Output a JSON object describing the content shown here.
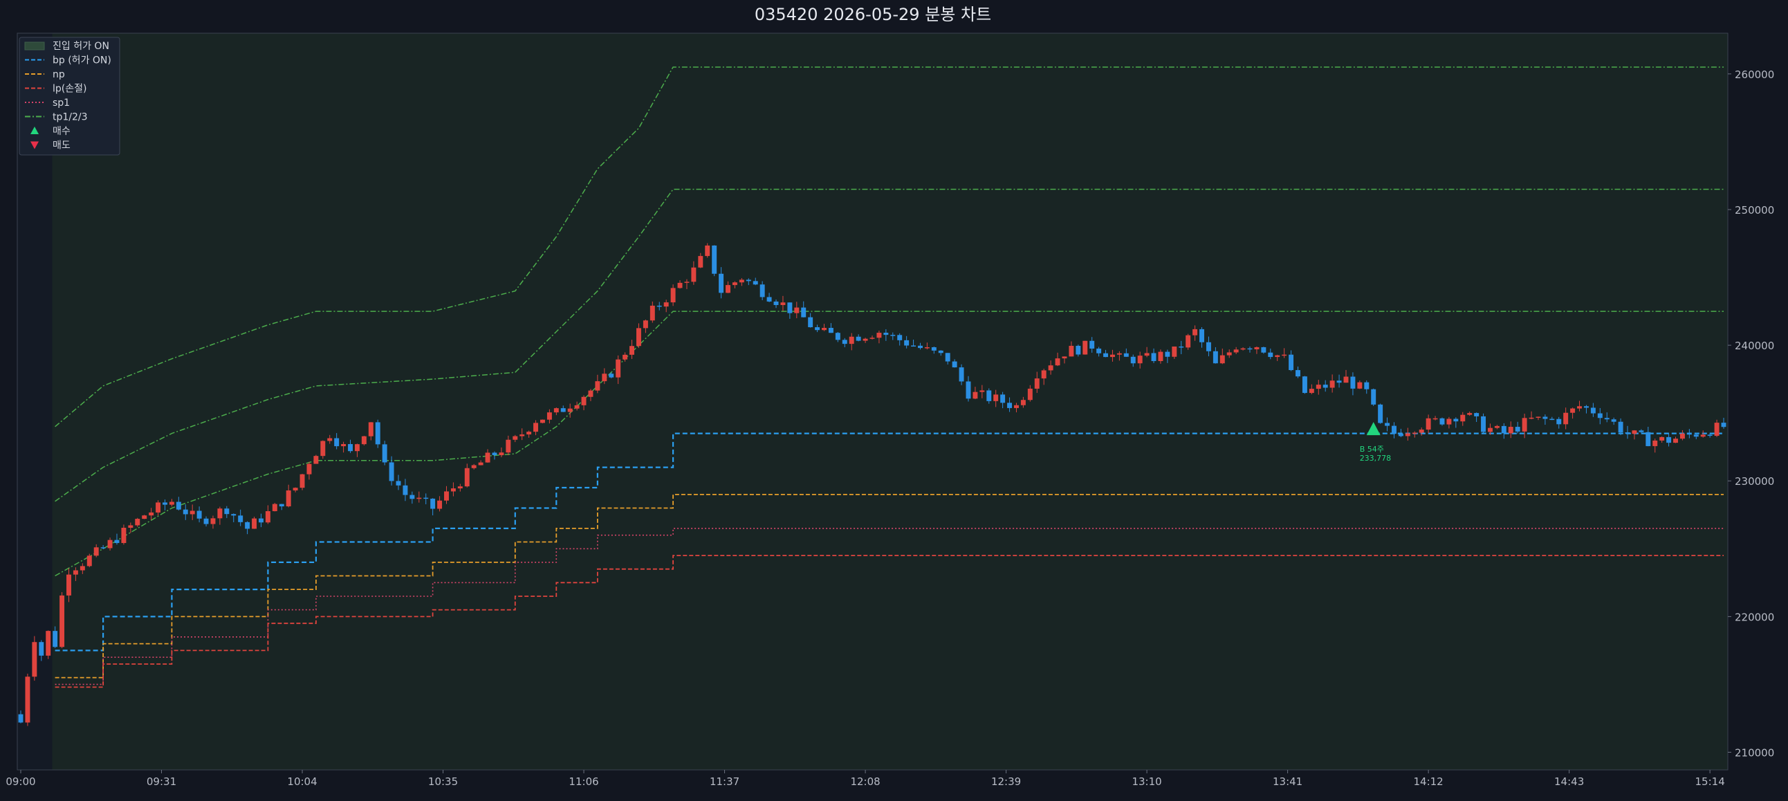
{
  "title": "035420  2026-05-29  분봉 차트",
  "colors": {
    "background": "#121620",
    "plot_bg": "#192524",
    "plot_bg_off": "#141a25",
    "up": "#e0443e",
    "down": "#2b8fe3",
    "bp": "#2b9ff0",
    "np": "#e79e2a",
    "lp": "#e0443e",
    "sp1": "#d9456a",
    "tp": "#4cad4c",
    "buy": "#22d67e",
    "sell": "#e8304a"
  },
  "chart_data": {
    "type": "candlestick",
    "title": "035420  2026-05-29  분봉 차트",
    "x_tick_labels": [
      "09:00",
      "09:31",
      "10:04",
      "10:35",
      "11:06",
      "11:37",
      "12:08",
      "12:39",
      "13:10",
      "13:41",
      "14:12",
      "14:43",
      "15:14"
    ],
    "y_tick_labels": [
      "210000",
      "220000",
      "230000",
      "240000",
      "250000",
      "260000"
    ],
    "ylim": [
      208700,
      263000
    ],
    "y_axis_side": "right",
    "legend": {
      "placement": "top-left",
      "entries": [
        {
          "label": "진입 허가 ON",
          "style": "patch"
        },
        {
          "label": "bp (허가 ON)",
          "style": "dashed"
        },
        {
          "label": "np",
          "style": "dashed"
        },
        {
          "label": "lp(손절)",
          "style": "dashed"
        },
        {
          "label": "sp1",
          "style": "dotted"
        },
        {
          "label": "tp1/2/3",
          "style": "dashdot"
        },
        {
          "label": "매수",
          "style": "triangle-up"
        },
        {
          "label": "매도",
          "style": "triangle-down"
        }
      ]
    },
    "permit_on_from_minute": 5,
    "close_path": [
      [
        0,
        212200
      ],
      [
        1,
        215800
      ],
      [
        2,
        218500
      ],
      [
        3,
        217200
      ],
      [
        4,
        218800
      ],
      [
        5,
        218000
      ],
      [
        6,
        221500
      ],
      [
        7,
        223500
      ],
      [
        9,
        224000
      ],
      [
        12,
        225000
      ],
      [
        15,
        226200
      ],
      [
        18,
        227500
      ],
      [
        22,
        228500
      ],
      [
        26,
        227000
      ],
      [
        30,
        228000
      ],
      [
        33,
        226500
      ],
      [
        37,
        228000
      ],
      [
        40,
        229500
      ],
      [
        42,
        231500
      ],
      [
        45,
        233500
      ],
      [
        48,
        232000
      ],
      [
        51,
        234500
      ],
      [
        53,
        231000
      ],
      [
        56,
        229000
      ],
      [
        60,
        228000
      ],
      [
        63,
        229500
      ],
      [
        66,
        231000
      ],
      [
        69,
        232000
      ],
      [
        72,
        233000
      ],
      [
        75,
        234500
      ],
      [
        78,
        235000
      ],
      [
        81,
        236000
      ],
      [
        84,
        237000
      ],
      [
        86,
        238000
      ],
      [
        88,
        239500
      ],
      [
        90,
        241000
      ],
      [
        92,
        242500
      ],
      [
        94,
        243500
      ],
      [
        96,
        244500
      ],
      [
        98,
        245500
      ],
      [
        100,
        247000
      ],
      [
        102,
        244000
      ],
      [
        105,
        245000
      ],
      [
        108,
        244000
      ],
      [
        111,
        243000
      ],
      [
        114,
        242000
      ],
      [
        116,
        241000
      ],
      [
        120,
        240500
      ],
      [
        125,
        241000
      ],
      [
        130,
        240000
      ],
      [
        135,
        239000
      ],
      [
        138,
        236500
      ],
      [
        142,
        236000
      ],
      [
        145,
        235500
      ],
      [
        148,
        238000
      ],
      [
        152,
        239500
      ],
      [
        156,
        240000
      ],
      [
        160,
        239000
      ],
      [
        164,
        239000
      ],
      [
        168,
        239500
      ],
      [
        171,
        241000
      ],
      [
        174,
        238500
      ],
      [
        177,
        240000
      ],
      [
        180,
        240000
      ],
      [
        184,
        239000
      ],
      [
        187,
        236500
      ],
      [
        190,
        237000
      ],
      [
        193,
        237500
      ],
      [
        196,
        236500
      ],
      [
        198,
        234000
      ],
      [
        200,
        233500
      ],
      [
        203,
        234000
      ],
      [
        207,
        234500
      ],
      [
        210,
        235000
      ],
      [
        213,
        234000
      ],
      [
        216,
        233500
      ],
      [
        220,
        234500
      ],
      [
        224,
        234500
      ],
      [
        227,
        235500
      ],
      [
        230,
        235000
      ],
      [
        234,
        233500
      ],
      [
        237,
        233000
      ],
      [
        240,
        233000
      ],
      [
        244,
        233500
      ],
      [
        248,
        234000
      ]
    ],
    "series": [
      {
        "name": "bp (허가 ON)",
        "values": [
          [
            5,
            217500
          ],
          [
            12,
            220000
          ],
          [
            22,
            222000
          ],
          [
            36,
            224000
          ],
          [
            43,
            225500
          ],
          [
            60,
            226500
          ],
          [
            72,
            228000
          ],
          [
            78,
            229500
          ],
          [
            84,
            231000
          ],
          [
            95,
            233500
          ],
          [
            248,
            233500
          ]
        ]
      },
      {
        "name": "np",
        "values": [
          [
            5,
            215500
          ],
          [
            12,
            218000
          ],
          [
            22,
            220000
          ],
          [
            36,
            222000
          ],
          [
            43,
            223000
          ],
          [
            60,
            224000
          ],
          [
            72,
            225500
          ],
          [
            78,
            226500
          ],
          [
            84,
            228000
          ],
          [
            95,
            229000
          ],
          [
            248,
            229000
          ]
        ]
      },
      {
        "name": "sp1",
        "values": [
          [
            5,
            215000
          ],
          [
            12,
            217000
          ],
          [
            22,
            218500
          ],
          [
            36,
            220500
          ],
          [
            43,
            221500
          ],
          [
            60,
            222500
          ],
          [
            72,
            224000
          ],
          [
            78,
            225000
          ],
          [
            84,
            226000
          ],
          [
            95,
            226500
          ],
          [
            248,
            226500
          ]
        ]
      },
      {
        "name": "lp(손절)",
        "values": [
          [
            5,
            214800
          ],
          [
            12,
            216500
          ],
          [
            22,
            217500
          ],
          [
            36,
            219500
          ],
          [
            43,
            220000
          ],
          [
            60,
            220500
          ],
          [
            72,
            221500
          ],
          [
            78,
            222500
          ],
          [
            84,
            223500
          ],
          [
            95,
            224500
          ],
          [
            248,
            224500
          ]
        ]
      },
      {
        "name": "tp1",
        "values": [
          [
            5,
            223000
          ],
          [
            12,
            225000
          ],
          [
            22,
            228000
          ],
          [
            36,
            230500
          ],
          [
            43,
            231500
          ],
          [
            60,
            231500
          ],
          [
            72,
            232000
          ],
          [
            78,
            234000
          ],
          [
            84,
            237000
          ],
          [
            90,
            240000
          ],
          [
            95,
            242500
          ],
          [
            248,
            242500
          ]
        ]
      },
      {
        "name": "tp2",
        "values": [
          [
            5,
            228500
          ],
          [
            12,
            231000
          ],
          [
            22,
            233500
          ],
          [
            36,
            236000
          ],
          [
            43,
            237000
          ],
          [
            60,
            237500
          ],
          [
            72,
            238000
          ],
          [
            78,
            241000
          ],
          [
            84,
            244000
          ],
          [
            90,
            248000
          ],
          [
            95,
            251500
          ],
          [
            248,
            251500
          ]
        ]
      },
      {
        "name": "tp3",
        "values": [
          [
            5,
            234000
          ],
          [
            12,
            237000
          ],
          [
            22,
            239000
          ],
          [
            36,
            241500
          ],
          [
            43,
            242500
          ],
          [
            60,
            242500
          ],
          [
            72,
            244000
          ],
          [
            78,
            248000
          ],
          [
            84,
            253000
          ],
          [
            90,
            256000
          ],
          [
            95,
            260500
          ],
          [
            248,
            260500
          ]
        ]
      }
    ],
    "markers": [
      {
        "type": "buy",
        "x": 197,
        "y": 233778,
        "label": "B 54주",
        "price_label": "233,778"
      }
    ]
  }
}
